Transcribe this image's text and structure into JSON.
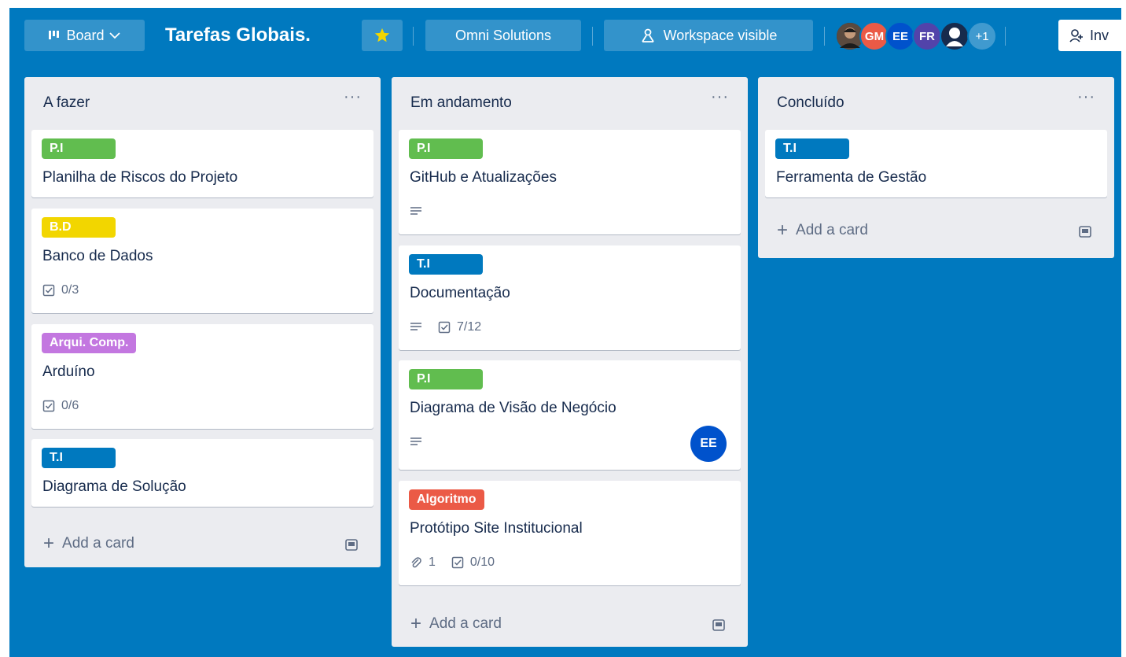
{
  "header": {
    "board_switch_label": "Board",
    "board_title": "Tarefas Globais.",
    "workspace_label": "Omni Solutions",
    "visibility_label": "Workspace visible",
    "members": [
      {
        "initials": "",
        "color": "#3d2f26"
      },
      {
        "initials": "GM",
        "color": "#eb5a46"
      },
      {
        "initials": "EE",
        "color": "#0052cc"
      },
      {
        "initials": "FR",
        "color": "#5243aa"
      },
      {
        "initials": "",
        "color": "#172b4d"
      }
    ],
    "more_members": "+1",
    "invite_label": "Inv"
  },
  "colors": {
    "board_bg": "#0079bf",
    "label_green": "#61bd4f",
    "label_yellow": "#f2d600",
    "label_purple": "#c377e0",
    "label_blue": "#0079bf",
    "label_red": "#eb5a46",
    "star": "#f2d600"
  },
  "add_card_label": "Add a card",
  "lists": [
    {
      "title": "A fazer",
      "cards": [
        {
          "label": "P.I",
          "title": "Planilha de Riscos do Projeto"
        },
        {
          "label": "B.D",
          "title": "Banco de Dados",
          "checklist": "0/3"
        },
        {
          "label": "Arqui. Comp.",
          "title": "Arduíno",
          "checklist": "0/6"
        },
        {
          "label": "T.I",
          "title": "Diagrama de Solução"
        }
      ]
    },
    {
      "title": "Em andamento",
      "cards": [
        {
          "label": "P.I",
          "title": "GitHub e Atualizações",
          "has_description": true
        },
        {
          "label": "T.I",
          "title": "Documentação",
          "has_description": true,
          "checklist": "7/12"
        },
        {
          "label": "P.I",
          "title": "Diagrama de Visão de Negócio",
          "has_description": true,
          "member": "EE"
        },
        {
          "label": "Algoritmo",
          "title": "Protótipo Site Institucional",
          "attachments": "1",
          "checklist": "0/10"
        }
      ]
    },
    {
      "title": "Concluído",
      "cards": [
        {
          "label": "T.I",
          "title": "Ferramenta de Gestão"
        }
      ]
    }
  ]
}
